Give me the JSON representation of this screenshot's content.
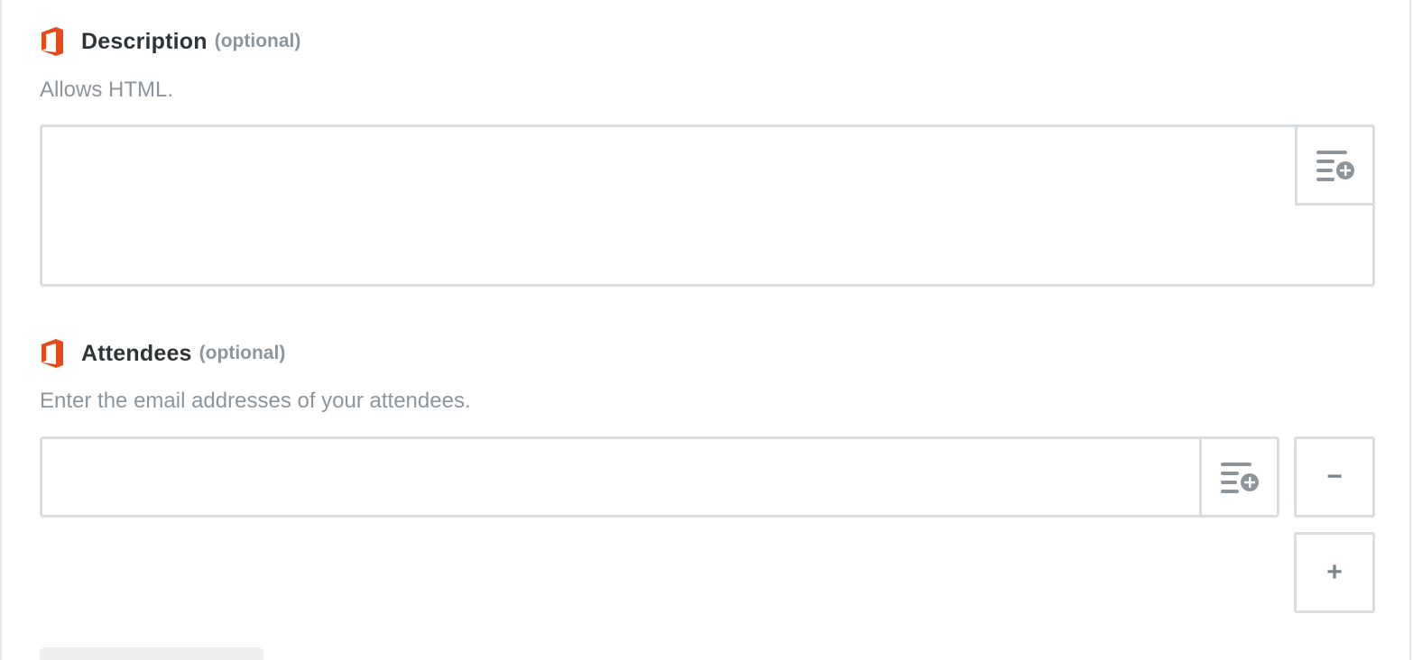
{
  "description_field": {
    "label": "Description",
    "optional_tag": "(optional)",
    "help_text": "Allows HTML.",
    "value": "",
    "insert_icon": "insert-field-icon"
  },
  "attendees_field": {
    "label": "Attendees",
    "optional_tag": "(optional)",
    "help_text": "Enter the email addresses of your attendees.",
    "value": "",
    "insert_icon": "insert-field-icon",
    "remove_label": "−",
    "add_label": "+"
  },
  "colors": {
    "office_brand": "#e64a19",
    "border": "#d9dde0",
    "muted_text": "#8d959c",
    "label_text": "#2f3438"
  }
}
